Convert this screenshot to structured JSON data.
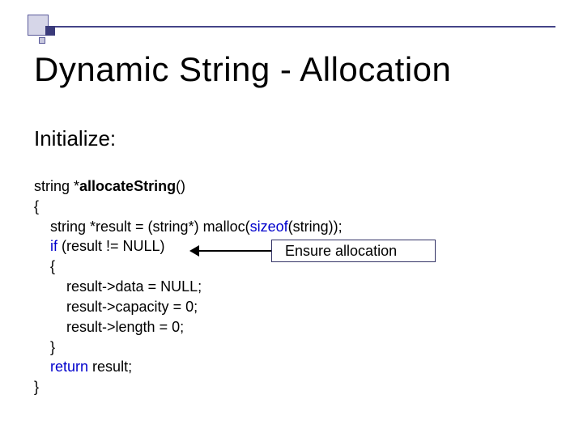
{
  "slide": {
    "title": "Dynamic String - Allocation",
    "subtitle": "Initialize:"
  },
  "code": {
    "line1_pre": "string *",
    "line1_bold": "allocateString",
    "line1_post": "()",
    "line2": "{",
    "line3_pre": "    string *result = (string*) malloc(",
    "line3_kw": "sizeof",
    "line3_post": "(string));",
    "line4_pre": "    ",
    "line4_kw": "if",
    "line4_post": " (result != NULL)",
    "line5": "    {",
    "line6": "        result->data = NULL;",
    "line7": "        result->capacity = 0;",
    "line8": "        result->length = 0;",
    "line9": "    }",
    "line10_pre": "    ",
    "line10_kw": "return",
    "line10_post": " result;",
    "line11": "}"
  },
  "callout": {
    "text": "Ensure allocation"
  }
}
